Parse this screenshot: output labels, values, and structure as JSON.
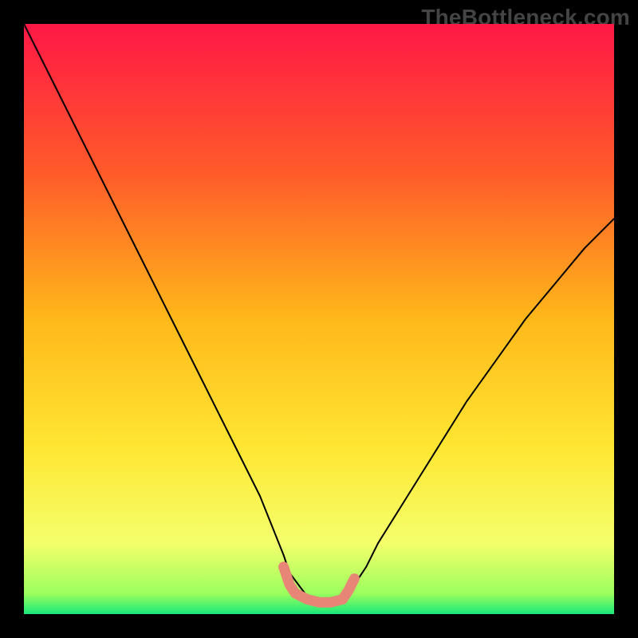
{
  "watermark": "TheBottleneck.com",
  "chart_data": {
    "type": "line",
    "title": "",
    "xlabel": "",
    "ylabel": "",
    "xlim": [
      0,
      100
    ],
    "ylim": [
      0,
      100
    ],
    "background_gradient": {
      "stops": [
        {
          "offset": 0.0,
          "color": "#ff1846"
        },
        {
          "offset": 0.25,
          "color": "#ff5a2a"
        },
        {
          "offset": 0.5,
          "color": "#ffb81a"
        },
        {
          "offset": 0.72,
          "color": "#ffe733"
        },
        {
          "offset": 0.88,
          "color": "#f4ff6b"
        },
        {
          "offset": 0.965,
          "color": "#9cff5e"
        },
        {
          "offset": 1.0,
          "color": "#18e879"
        }
      ]
    },
    "series": [
      {
        "name": "bottleneck-curve",
        "color": "#000000",
        "width": 2,
        "x": [
          0,
          2,
          5,
          10,
          15,
          20,
          25,
          30,
          35,
          40,
          42,
          44,
          45,
          48,
          50,
          52,
          54,
          56,
          58,
          60,
          65,
          70,
          75,
          80,
          85,
          90,
          95,
          100
        ],
        "y": [
          100,
          96,
          90,
          80,
          70,
          60,
          50,
          40,
          30,
          20,
          15,
          10,
          7,
          3,
          2,
          2,
          3,
          5,
          8,
          12,
          20,
          28,
          36,
          43,
          50,
          56,
          62,
          67
        ]
      },
      {
        "name": "bottom-zone",
        "color": "#e78677",
        "width": 13,
        "x": [
          44,
          45,
          46,
          48,
          50,
          52,
          54,
          55,
          56
        ],
        "y": [
          8,
          5,
          3.5,
          2.5,
          2,
          2,
          2.5,
          4,
          6
        ]
      }
    ]
  }
}
